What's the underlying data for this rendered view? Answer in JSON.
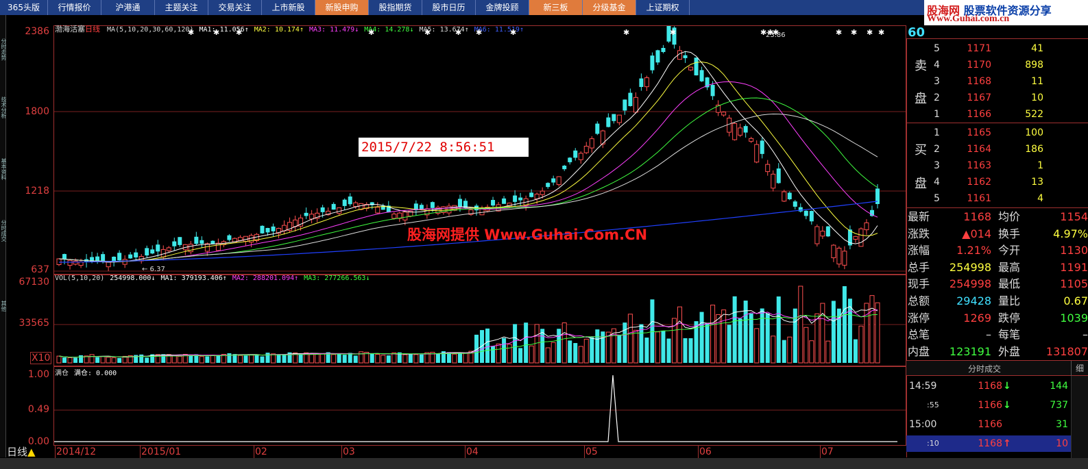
{
  "tabs": [
    {
      "label": "365头版",
      "orange": false
    },
    {
      "label": "行情报价",
      "orange": false
    },
    {
      "label": "沪港通",
      "orange": false
    },
    {
      "label": "主题关注",
      "orange": false
    },
    {
      "label": "交易关注",
      "orange": false
    },
    {
      "label": "上市新股",
      "orange": false
    },
    {
      "label": "新股申购",
      "orange": true
    },
    {
      "label": "股指期货",
      "orange": false
    },
    {
      "label": "股市日历",
      "orange": false
    },
    {
      "label": "金牌投顾",
      "orange": false
    },
    {
      "label": "新三板",
      "orange": true
    },
    {
      "label": "分级基金",
      "orange": true
    },
    {
      "label": "上证期权",
      "orange": false
    }
  ],
  "logo": {
    "line1_a": "股海网",
    "line1_b": "股票软件资源分享",
    "line2": "Www.Guhai.com.cn"
  },
  "left_strip": [
    "分时走势",
    "技术分析",
    "基本资料",
    "分时成交",
    "其他"
  ],
  "main_chart": {
    "stock_name": "渤海活塞",
    "period": "日线",
    "ma_legend": [
      {
        "text": "MA(5,10,20,30,60,120)",
        "color": "#dddddd"
      },
      {
        "text": "MA1: 11.056↑",
        "color": "#ffffff"
      },
      {
        "text": "MA2: 10.174↑",
        "color": "#ffff40"
      },
      {
        "text": "MA3: 11.479↓",
        "color": "#ff40ff"
      },
      {
        "text": "MA4: 14.278↓",
        "color": "#40ff40"
      },
      {
        "text": "MA5: 13.674↑",
        "color": "#dddddd"
      },
      {
        "text": "MA6: 11.519↑",
        "color": "#4060ff"
      }
    ],
    "y_labels": [
      "2386",
      "1800",
      "1218",
      "637"
    ],
    "peak_label": "23.86",
    "low_label": "6.37",
    "datetime_box": "2015/7/22  8:56:51",
    "watermark": "股海网提供  Www.Guhai.Com.CN"
  },
  "vol_chart": {
    "legend": [
      {
        "text": "VOL(5,10,20)",
        "color": "#dddddd"
      },
      {
        "text": "254998.000↓",
        "color": "#ffffff"
      },
      {
        "text": "MA1: 379193.406↑",
        "color": "#ffffff"
      },
      {
        "text": "MA2: 288201.094↑",
        "color": "#ff40ff"
      },
      {
        "text": "MA3: 277266.563↓",
        "color": "#40ff40"
      }
    ],
    "y_labels": [
      "67130",
      "33565"
    ],
    "unit": "X10"
  },
  "ind_chart": {
    "legend": [
      {
        "text": "满仓",
        "color": "#dddddd"
      },
      {
        "text": "满仓: 0.000",
        "color": "#ffffff"
      }
    ],
    "y_labels": [
      "1.00",
      "0.49",
      "0.00"
    ]
  },
  "date_axis": [
    "2014/12",
    "2015/01",
    "02",
    "03",
    "04",
    "05",
    "06",
    "07"
  ],
  "period_btn": "日线",
  "right_panel": {
    "code_partial": "60",
    "sell_label": [
      "卖",
      "盘"
    ],
    "buy_label": [
      "买",
      "盘"
    ],
    "sell": [
      {
        "i": "5",
        "p": "1171",
        "v": "41"
      },
      {
        "i": "4",
        "p": "1170",
        "v": "898"
      },
      {
        "i": "3",
        "p": "1168",
        "v": "11"
      },
      {
        "i": "2",
        "p": "1167",
        "v": "10"
      },
      {
        "i": "1",
        "p": "1166",
        "v": "522"
      }
    ],
    "buy": [
      {
        "i": "1",
        "p": "1165",
        "v": "100"
      },
      {
        "i": "2",
        "p": "1164",
        "v": "186"
      },
      {
        "i": "3",
        "p": "1163",
        "v": "1"
      },
      {
        "i": "4",
        "p": "1162",
        "v": "13"
      },
      {
        "i": "5",
        "p": "1161",
        "v": "4"
      }
    ],
    "quote": [
      {
        "l": "最新",
        "v": "1168",
        "vc": "#ff4040",
        "l2": "均价",
        "v2": "1154",
        "v2c": "#ff4040"
      },
      {
        "l": "涨跌",
        "v": "▲014",
        "vc": "#ff4040",
        "l2": "换手",
        "v2": "4.97%",
        "v2c": "#ffff40"
      },
      {
        "l": "涨幅",
        "v": "1.21%",
        "vc": "#ff4040",
        "l2": "今开",
        "v2": "1130",
        "v2c": "#ff4040"
      },
      {
        "l": "总手",
        "v": "254998",
        "vc": "#ffff40",
        "l2": "最高",
        "v2": "1191",
        "v2c": "#ff4040"
      },
      {
        "l": "现手",
        "v": "254998",
        "vc": "#ff4040",
        "l2": "最低",
        "v2": "1105",
        "v2c": "#ff4040"
      },
      {
        "l": "总额",
        "v": "29428",
        "vc": "#40e0ff",
        "l2": "量比",
        "v2": "0.67",
        "v2c": "#ffff40"
      },
      {
        "l": "涨停",
        "v": "1269",
        "vc": "#ff4040",
        "l2": "跌停",
        "v2": "1039",
        "v2c": "#40ff40"
      },
      {
        "l": "总笔",
        "v": "–",
        "vc": "#ddd",
        "l2": "每笔",
        "v2": "–",
        "v2c": "#ddd"
      },
      {
        "l": "内盘",
        "v": "123191",
        "vc": "#40ff40",
        "l2": "外盘",
        "v2": "131807",
        "v2c": "#ff4040"
      }
    ],
    "trades_title": "分时成交",
    "trades_btn": "细",
    "trades": [
      {
        "t": "14:59",
        "p": "1168",
        "arrow": "↓",
        "ac": "#40ff40",
        "v": "144",
        "vc": "#40ff40"
      },
      {
        "t": ":55",
        "p": "1166",
        "arrow": "↓",
        "ac": "#40ff40",
        "v": "737",
        "vc": "#40ff40"
      },
      {
        "t": "15:00",
        "p": "1166",
        "arrow": "",
        "ac": "#ddd",
        "v": "31",
        "vc": "#40ff40"
      },
      {
        "t": ":10",
        "p": "1168",
        "arrow": "↑",
        "ac": "#ff4040",
        "v": "10",
        "vc": "#ff4040"
      }
    ]
  }
}
